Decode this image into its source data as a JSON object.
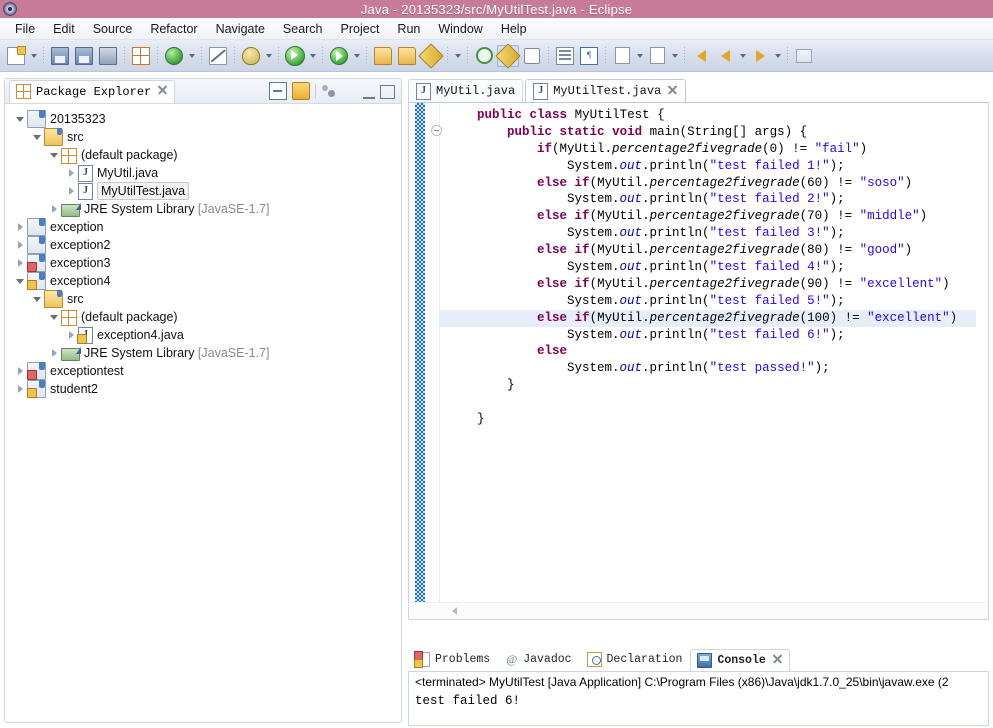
{
  "window": {
    "title": "Java - 20135323/src/MyUtilTest.java - Eclipse",
    "logo_icon": "eclipse-logo-icon",
    "titlebar_color": "#c77b96"
  },
  "menubar": {
    "items": [
      {
        "label": "File"
      },
      {
        "label": "Edit"
      },
      {
        "label": "Source"
      },
      {
        "label": "Refactor"
      },
      {
        "label": "Navigate"
      },
      {
        "label": "Search"
      },
      {
        "label": "Project"
      },
      {
        "label": "Run"
      },
      {
        "label": "Window"
      },
      {
        "label": "Help"
      }
    ]
  },
  "toolbar": {
    "buttons": [
      {
        "name": "new-icon",
        "kind": "doc"
      },
      {
        "name": "new-dropdown-arrow-icon",
        "kind": "arrow"
      },
      {
        "name": "save-icon",
        "kind": "disk"
      },
      {
        "name": "save-all-icon",
        "kind": "disk"
      },
      {
        "name": "print-icon",
        "kind": "printer"
      },
      {
        "name": "new-java-package-icon",
        "kind": "pkg"
      },
      {
        "name": "refresh-icon",
        "kind": "greenc"
      },
      {
        "name": "refresh-dropdown-arrow-icon",
        "kind": "arrow"
      },
      {
        "name": "skip-breakpoints-icon",
        "kind": "nolimit"
      },
      {
        "name": "debug-icon",
        "kind": "bug"
      },
      {
        "name": "debug-dropdown-arrow-icon",
        "kind": "arrow"
      },
      {
        "name": "run-icon",
        "kind": "play"
      },
      {
        "name": "run-dropdown-arrow-icon",
        "kind": "arrow"
      },
      {
        "name": "run-external-tools-icon",
        "kind": "playred"
      },
      {
        "name": "external-tools-dropdown-arrow-icon",
        "kind": "arrow"
      },
      {
        "name": "open-type-icon",
        "kind": "folderp"
      },
      {
        "name": "open-task-icon",
        "kind": "folder"
      },
      {
        "name": "new-java-class-icon",
        "kind": "pen"
      },
      {
        "name": "new-class-dropdown-arrow-icon",
        "kind": "arrow"
      },
      {
        "name": "search-icon",
        "kind": "searchg"
      },
      {
        "name": "annotation-icon",
        "kind": "penactive",
        "active": true
      },
      {
        "name": "toggle-mark-occurrences-icon",
        "kind": "markocc"
      },
      {
        "name": "show-outline-icon",
        "kind": "outline"
      },
      {
        "name": "show-whitespace-icon",
        "kind": "pilcrow"
      },
      {
        "name": "next-annotation-icon",
        "kind": "downann"
      },
      {
        "name": "next-annotation-dropdown-arrow-icon",
        "kind": "arrow"
      },
      {
        "name": "previous-annotation-icon",
        "kind": "upann"
      },
      {
        "name": "previous-annotation-dropdown-arrow-icon",
        "kind": "arrow"
      },
      {
        "name": "back-icon",
        "kind": "arrowL"
      },
      {
        "name": "forward-back-icon",
        "kind": "arrowL"
      },
      {
        "name": "back-dropdown-arrow-icon",
        "kind": "arrow"
      },
      {
        "name": "forward-icon",
        "kind": "arrowR"
      },
      {
        "name": "forward-dropdown-arrow-icon",
        "kind": "arrow"
      },
      {
        "name": "perspective-icon",
        "kind": "persp"
      }
    ]
  },
  "package_explorer": {
    "tab_label": "Package Explorer",
    "tab_icon": "package-explorer-icon",
    "close_icon": "close-icon",
    "tools": [
      {
        "name": "collapse-all-icon"
      },
      {
        "name": "link-with-editor-icon"
      },
      {
        "name": "view-menu-icon"
      },
      {
        "name": "view-dropdown-icon"
      },
      {
        "name": "minimize-view-icon"
      },
      {
        "name": "maximize-view-icon"
      }
    ],
    "tree": [
      {
        "label": "20135323",
        "indent": 0,
        "twist": "open",
        "icon": "project",
        "selected": false
      },
      {
        "label": "src",
        "indent": 1,
        "twist": "open",
        "icon": "srcfolder",
        "selected": false
      },
      {
        "label": "(default package)",
        "indent": 2,
        "twist": "open",
        "icon": "package",
        "selected": false
      },
      {
        "label": "MyUtil.java",
        "indent": 3,
        "twist": "closed",
        "icon": "java",
        "selected": false
      },
      {
        "label": "MyUtilTest.java",
        "indent": 3,
        "twist": "closed",
        "icon": "java",
        "selected": true
      },
      {
        "label": "JRE System Library ",
        "dim": "[JavaSE-1.7]",
        "indent": 2,
        "twist": "closed",
        "icon": "jre",
        "selected": false
      },
      {
        "label": "exception",
        "indent": 0,
        "twist": "closed",
        "icon": "project",
        "selected": false
      },
      {
        "label": "exception2",
        "indent": 0,
        "twist": "closed",
        "icon": "project",
        "selected": false
      },
      {
        "label": "exception3",
        "indent": 0,
        "twist": "closed",
        "icon": "project-error",
        "selected": false
      },
      {
        "label": "exception4",
        "indent": 0,
        "twist": "open",
        "icon": "project-warn",
        "selected": false
      },
      {
        "label": "src",
        "indent": 1,
        "twist": "open",
        "icon": "srcfolder-warn",
        "selected": false
      },
      {
        "label": "(default package)",
        "indent": 2,
        "twist": "open",
        "icon": "package-warn",
        "selected": false
      },
      {
        "label": "exception4.java",
        "indent": 3,
        "twist": "closed",
        "icon": "java-warn",
        "selected": false
      },
      {
        "label": "JRE System Library ",
        "dim": "[JavaSE-1.7]",
        "indent": 2,
        "twist": "closed",
        "icon": "jre",
        "selected": false
      },
      {
        "label": "exceptiontest",
        "indent": 0,
        "twist": "closed",
        "icon": "project-error",
        "selected": false
      },
      {
        "label": "student2",
        "indent": 0,
        "twist": "closed",
        "icon": "project-warn",
        "selected": false
      }
    ]
  },
  "editor": {
    "tabs": [
      {
        "label": "MyUtil.java",
        "active": false,
        "closable": false,
        "icon": "java-file-icon"
      },
      {
        "label": "MyUtilTest.java",
        "active": true,
        "closable": true,
        "icon": "java-file-icon",
        "close_icon": "close-icon"
      }
    ],
    "fold_icon": "collapse-method-icon",
    "hscroll_left_icon": "scroll-left-arrow-icon",
    "code_lines": [
      {
        "indent": 1,
        "highlight": false,
        "tokens": [
          {
            "t": "public",
            "c": "kw"
          },
          {
            "t": " ",
            "c": ""
          },
          {
            "t": "class",
            "c": "kw"
          },
          {
            "t": " MyUtilTest {",
            "c": ""
          }
        ]
      },
      {
        "indent": 2,
        "highlight": false,
        "tokens": [
          {
            "t": "public",
            "c": "kw"
          },
          {
            "t": " ",
            "c": ""
          },
          {
            "t": "static",
            "c": "kw"
          },
          {
            "t": " ",
            "c": ""
          },
          {
            "t": "void",
            "c": "kw"
          },
          {
            "t": " main(String[] args) {",
            "c": ""
          }
        ]
      },
      {
        "indent": 3,
        "highlight": false,
        "tokens": [
          {
            "t": "if",
            "c": "kw"
          },
          {
            "t": "(MyUtil.",
            "c": ""
          },
          {
            "t": "percentage2fivegrade",
            "c": "mth"
          },
          {
            "t": "(0) != ",
            "c": ""
          },
          {
            "t": "\"fail\"",
            "c": "str"
          },
          {
            "t": ")",
            "c": ""
          }
        ]
      },
      {
        "indent": 4,
        "highlight": false,
        "tokens": [
          {
            "t": "System.",
            "c": ""
          },
          {
            "t": "out",
            "c": "fld"
          },
          {
            "t": ".println(",
            "c": ""
          },
          {
            "t": "\"test failed 1!\"",
            "c": "str"
          },
          {
            "t": ");",
            "c": ""
          }
        ]
      },
      {
        "indent": 3,
        "highlight": false,
        "tokens": [
          {
            "t": "else",
            "c": "kw"
          },
          {
            "t": " ",
            "c": ""
          },
          {
            "t": "if",
            "c": "kw"
          },
          {
            "t": "(MyUtil.",
            "c": ""
          },
          {
            "t": "percentage2fivegrade",
            "c": "mth"
          },
          {
            "t": "(60) != ",
            "c": ""
          },
          {
            "t": "\"soso\"",
            "c": "str"
          },
          {
            "t": ")",
            "c": ""
          }
        ]
      },
      {
        "indent": 4,
        "highlight": false,
        "tokens": [
          {
            "t": "System.",
            "c": ""
          },
          {
            "t": "out",
            "c": "fld"
          },
          {
            "t": ".println(",
            "c": ""
          },
          {
            "t": "\"test failed 2!\"",
            "c": "str"
          },
          {
            "t": ");",
            "c": ""
          }
        ]
      },
      {
        "indent": 3,
        "highlight": false,
        "tokens": [
          {
            "t": "else",
            "c": "kw"
          },
          {
            "t": " ",
            "c": ""
          },
          {
            "t": "if",
            "c": "kw"
          },
          {
            "t": "(MyUtil.",
            "c": ""
          },
          {
            "t": "percentage2fivegrade",
            "c": "mth"
          },
          {
            "t": "(70) != ",
            "c": ""
          },
          {
            "t": "\"middle\"",
            "c": "str"
          },
          {
            "t": ")",
            "c": ""
          }
        ]
      },
      {
        "indent": 4,
        "highlight": false,
        "tokens": [
          {
            "t": "System.",
            "c": ""
          },
          {
            "t": "out",
            "c": "fld"
          },
          {
            "t": ".println(",
            "c": ""
          },
          {
            "t": "\"test failed 3!\"",
            "c": "str"
          },
          {
            "t": ");",
            "c": ""
          }
        ]
      },
      {
        "indent": 3,
        "highlight": false,
        "tokens": [
          {
            "t": "else",
            "c": "kw"
          },
          {
            "t": " ",
            "c": ""
          },
          {
            "t": "if",
            "c": "kw"
          },
          {
            "t": "(MyUtil.",
            "c": ""
          },
          {
            "t": "percentage2fivegrade",
            "c": "mth"
          },
          {
            "t": "(80) != ",
            "c": ""
          },
          {
            "t": "\"good\"",
            "c": "str"
          },
          {
            "t": ")",
            "c": ""
          }
        ]
      },
      {
        "indent": 4,
        "highlight": false,
        "tokens": [
          {
            "t": "System.",
            "c": ""
          },
          {
            "t": "out",
            "c": "fld"
          },
          {
            "t": ".println(",
            "c": ""
          },
          {
            "t": "\"test failed 4!\"",
            "c": "str"
          },
          {
            "t": ");",
            "c": ""
          }
        ]
      },
      {
        "indent": 3,
        "highlight": false,
        "tokens": [
          {
            "t": "else",
            "c": "kw"
          },
          {
            "t": " ",
            "c": ""
          },
          {
            "t": "if",
            "c": "kw"
          },
          {
            "t": "(MyUtil.",
            "c": ""
          },
          {
            "t": "percentage2fivegrade",
            "c": "mth"
          },
          {
            "t": "(90) != ",
            "c": ""
          },
          {
            "t": "\"excellent\"",
            "c": "str"
          },
          {
            "t": ")",
            "c": ""
          }
        ]
      },
      {
        "indent": 4,
        "highlight": false,
        "tokens": [
          {
            "t": "System.",
            "c": ""
          },
          {
            "t": "out",
            "c": "fld"
          },
          {
            "t": ".println(",
            "c": ""
          },
          {
            "t": "\"test failed 5!\"",
            "c": "str"
          },
          {
            "t": ");",
            "c": ""
          }
        ]
      },
      {
        "indent": 3,
        "highlight": true,
        "tokens": [
          {
            "t": "else",
            "c": "kw"
          },
          {
            "t": " ",
            "c": ""
          },
          {
            "t": "if",
            "c": "kw"
          },
          {
            "t": "(MyUtil.",
            "c": ""
          },
          {
            "t": "percentage2fivegrade",
            "c": "mth"
          },
          {
            "t": "(100) != ",
            "c": ""
          },
          {
            "t": "\"excellent\"",
            "c": "str"
          },
          {
            "t": ")",
            "c": ""
          }
        ]
      },
      {
        "indent": 4,
        "highlight": false,
        "tokens": [
          {
            "t": "System.",
            "c": ""
          },
          {
            "t": "out",
            "c": "fld"
          },
          {
            "t": ".println(",
            "c": ""
          },
          {
            "t": "\"test failed 6!\"",
            "c": "str"
          },
          {
            "t": ");",
            "c": ""
          }
        ]
      },
      {
        "indent": 3,
        "highlight": false,
        "tokens": [
          {
            "t": "else",
            "c": "kw"
          }
        ]
      },
      {
        "indent": 4,
        "highlight": false,
        "tokens": [
          {
            "t": "System.",
            "c": ""
          },
          {
            "t": "out",
            "c": "fld"
          },
          {
            "t": ".println(",
            "c": ""
          },
          {
            "t": "\"test passed!\"",
            "c": "str"
          },
          {
            "t": ");",
            "c": ""
          }
        ]
      },
      {
        "indent": 2,
        "highlight": false,
        "tokens": [
          {
            "t": "}",
            "c": ""
          }
        ]
      },
      {
        "indent": 0,
        "highlight": false,
        "tokens": []
      },
      {
        "indent": 1,
        "highlight": false,
        "tokens": [
          {
            "t": "}",
            "c": ""
          }
        ]
      }
    ]
  },
  "bottom_panel": {
    "tabs": [
      {
        "label": "Problems",
        "active": false,
        "icon": "problems-icon"
      },
      {
        "label": "Javadoc",
        "active": false,
        "icon": "javadoc-icon"
      },
      {
        "label": "Declaration",
        "active": false,
        "icon": "declaration-icon"
      },
      {
        "label": "Console",
        "active": true,
        "icon": "console-icon",
        "close_icon": "close-icon"
      }
    ],
    "console": {
      "header": "<terminated> MyUtilTest [Java Application] C:\\Program Files (x86)\\Java\\jdk1.7.0_25\\bin\\javaw.exe (2",
      "output": "test failed 6!"
    }
  },
  "colors": {
    "title_bar": "#c77b96",
    "toolbar_top": "#e9eef7",
    "keyword": "#7f0055",
    "string": "#2a00ff",
    "field": "#0000c0",
    "highlight_line": "#e8eef9",
    "change_bar": "#1f6fc4"
  }
}
